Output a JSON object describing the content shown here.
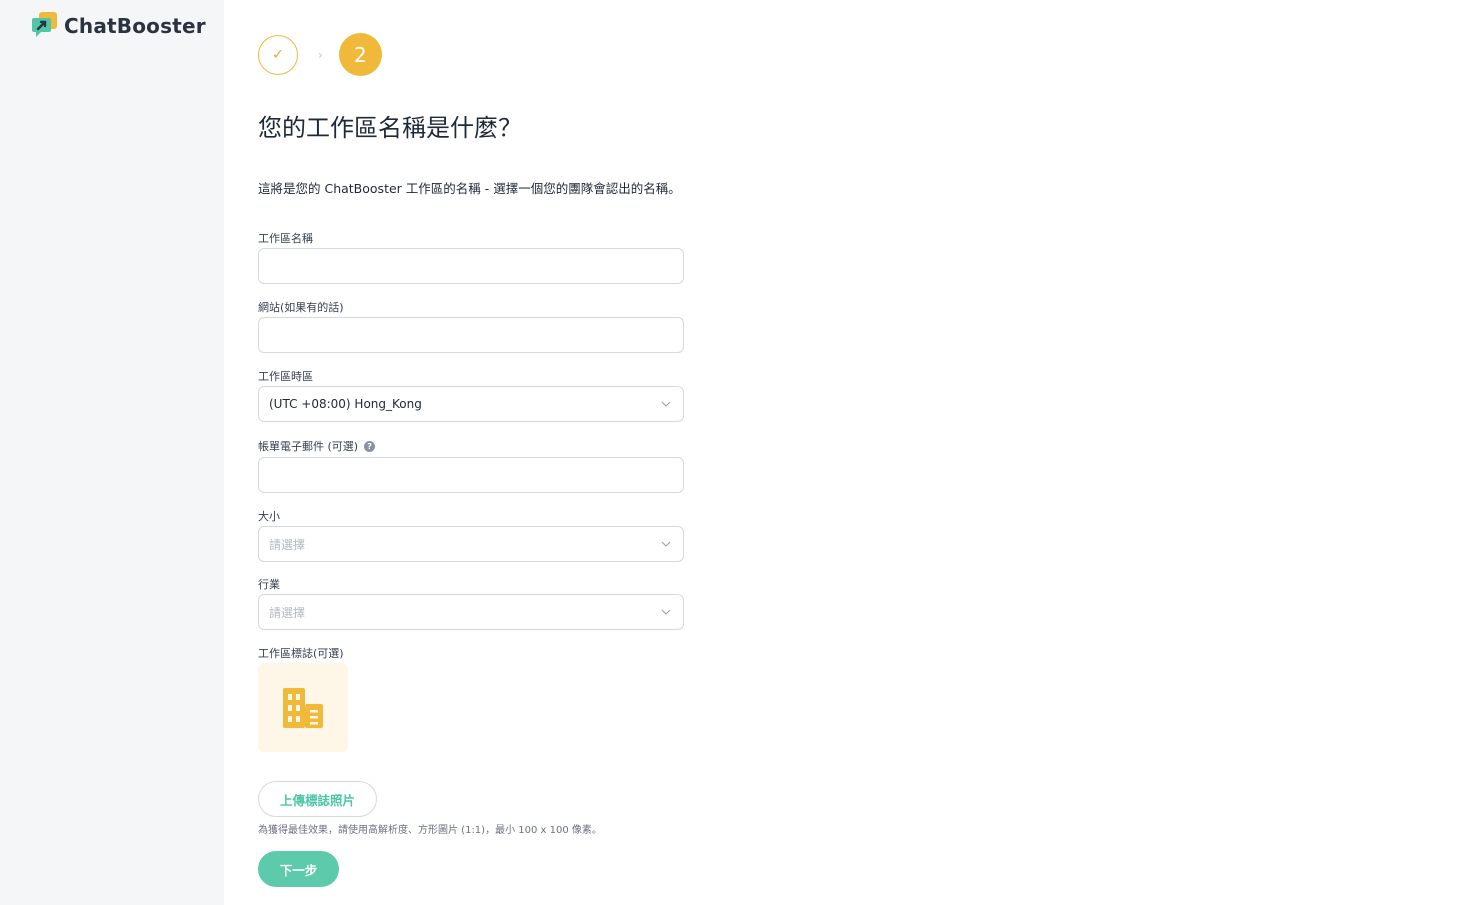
{
  "brand": {
    "name": "ChatBooster",
    "colors": {
      "accent": "#f0b93a",
      "primary": "#5dcbab",
      "logo_green": "#4fc6a8",
      "logo_dark": "#2b3240"
    }
  },
  "stepper": {
    "steps": [
      {
        "state": "completed",
        "icon": "checkmark-icon",
        "glyph": "✓"
      },
      {
        "state": "current",
        "number": "2"
      }
    ],
    "separator_glyph": "›"
  },
  "page": {
    "title": "您的工作區名稱是什麼？",
    "subtitle": "這將是您的 ChatBooster 工作區的名稱 - 選擇一個您的團隊會認出的名稱。"
  },
  "form": {
    "workspace_name": {
      "label": "工作區名稱",
      "value": ""
    },
    "website": {
      "label": "網站(如果有的話)",
      "value": ""
    },
    "timezone": {
      "label": "工作區時區",
      "value": "(UTC +08:00) Hong_Kong"
    },
    "billing_email": {
      "label": "帳單電子郵件 (可選)",
      "help_glyph": "?",
      "value": ""
    },
    "size": {
      "label": "大小",
      "placeholder": "請選擇"
    },
    "industry": {
      "label": "行業",
      "placeholder": "請選擇"
    },
    "logo": {
      "label": "工作區標誌(可選)",
      "upload_button": "上傳標誌照片",
      "hint": "為獲得最佳效果，請使用高解析度、方形圖片 (1:1)，最小 100 x 100 像素。"
    },
    "next_button": "下一步"
  }
}
